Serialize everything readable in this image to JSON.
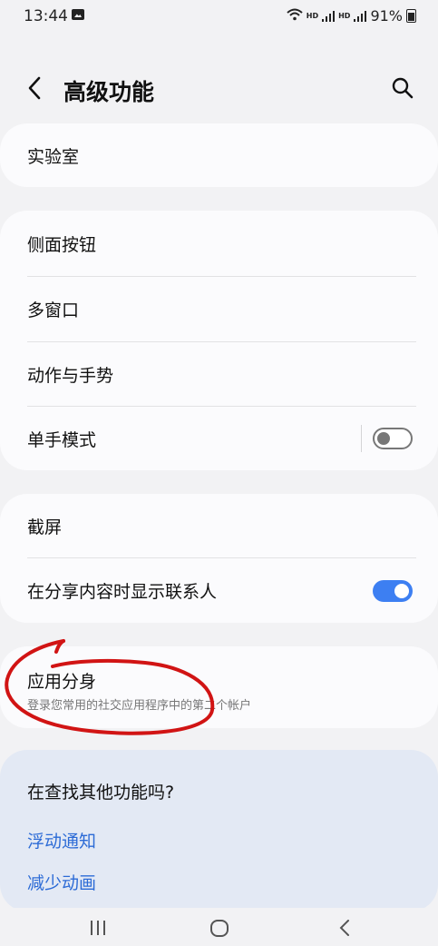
{
  "status_bar": {
    "time": "13:44",
    "hd1": "HD",
    "hd2": "HD",
    "battery": "91%"
  },
  "header": {
    "title": "高级功能"
  },
  "cards": {
    "lab": {
      "label": "实验室"
    },
    "group2": {
      "side_button": "侧面按钮",
      "multi_window": "多窗口",
      "motions": "动作与手势",
      "one_hand": "单手模式",
      "one_hand_toggle": "off"
    },
    "group3": {
      "screenshot": "截屏",
      "show_contacts": "在分享内容时显示联系人",
      "show_contacts_toggle": "on"
    },
    "dual_app": {
      "label": "应用分身",
      "sub": "登录您常用的社交应用程序中的第二个帐户"
    }
  },
  "suggestions": {
    "title": "在查找其他功能吗?",
    "links": [
      "浮动通知",
      "减少动画"
    ]
  },
  "colors": {
    "accent": "#3d7ff2",
    "link": "#2c6bd6",
    "annotation": "#d11414"
  }
}
